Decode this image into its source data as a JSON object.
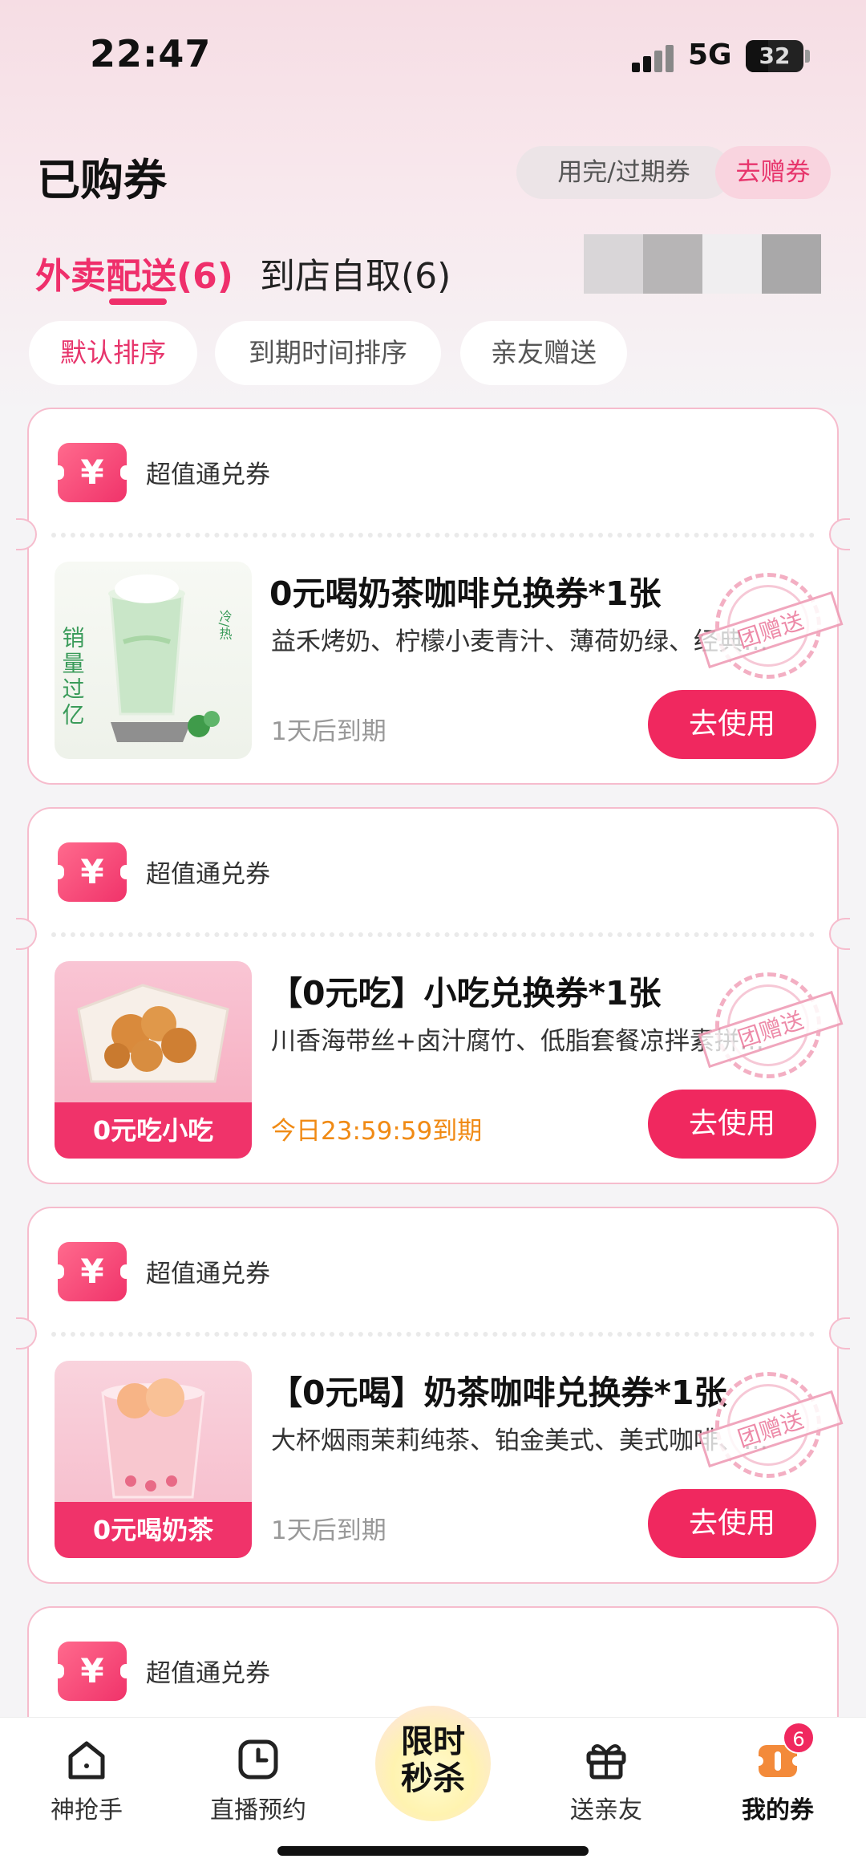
{
  "status": {
    "time": "22:47",
    "network": "5G",
    "battery": "32"
  },
  "header": {
    "title": "已购券",
    "expired_btn": "用完/过期券",
    "gift_btn": "去赠券"
  },
  "tabs": [
    {
      "label": "外卖配送(6)"
    },
    {
      "label": "到店自取(6)"
    }
  ],
  "sort": [
    {
      "label": "默认排序"
    },
    {
      "label": "到期时间排序"
    },
    {
      "label": "亲友赠送"
    }
  ],
  "cards": [
    {
      "type": "超值通兑券",
      "title": "0元喝奶茶咖啡兑换券*1张",
      "desc": "益禾烤奶、柠檬小麦青汁、薄荷奶绿、经典…",
      "expiry": "1天后到期",
      "use": "去使用",
      "stamp": "团赠送",
      "thumb_text": "销量过亿",
      "thumb_tag": "冷/热"
    },
    {
      "type": "超值通兑券",
      "title": "【0元吃】小吃兑换券*1张",
      "desc": "川香海带丝+卤汁腐竹、低脂套餐凉拌素拼…",
      "expiry": "今日23:59:59到期",
      "use": "去使用",
      "stamp": "团赠送",
      "thumb_caption": "0元吃小吃"
    },
    {
      "type": "超值通兑券",
      "title": "【0元喝】奶茶咖啡兑换券*1张",
      "desc": "大杯烟雨茉莉纯茶、铂金美式、美式咖啡、…",
      "expiry": "1天后到期",
      "use": "去使用",
      "stamp": "团赠送",
      "thumb_caption": "0元喝奶茶"
    },
    {
      "type": "超值通兑券"
    }
  ],
  "coupon_symbol": "¥",
  "nav": {
    "items": [
      {
        "label": "神抢手"
      },
      {
        "label": "直播预约"
      },
      {
        "label": "送亲友"
      },
      {
        "label": "我的券"
      }
    ],
    "flash": "限时秒杀",
    "badge": "6"
  },
  "colors": {
    "accent": "#f0285f",
    "warn": "#f08a14"
  }
}
